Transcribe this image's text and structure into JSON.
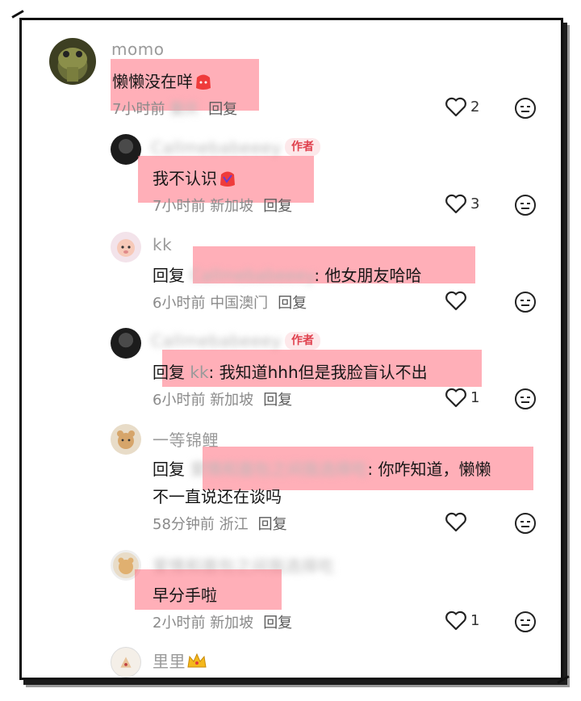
{
  "comments": [
    {
      "name": "momo",
      "text": "懒懒没在咩",
      "meta_time": "7小时前",
      "meta_loc": "重庆",
      "reply": "回复",
      "likes": "2"
    },
    {
      "name": "Callmebabeeey",
      "badge": "作者",
      "text": "我不认识",
      "meta_time": "7小时前",
      "meta_loc": "新加坡",
      "reply": "回复",
      "likes": "3"
    },
    {
      "name": "kk",
      "reply_prefix": "回复",
      "mention": "Callmebabeeey",
      "text": ": 他女朋友哈哈",
      "meta_time": "6小时前",
      "meta_loc": "中国澳门",
      "reply": "回复",
      "likes": ""
    },
    {
      "name": "Callmebabeeey",
      "badge": "作者",
      "reply_prefix": "回复",
      "mention": "kk",
      "text": ": 我知道hhh但是我脸盲认不出",
      "meta_time": "6小时前",
      "meta_loc": "新加坡",
      "reply": "回复",
      "likes": "1"
    },
    {
      "name": "一等锦鲤",
      "reply_prefix": "回复",
      "mention": "爱情和面包之间我选择吃",
      "text": ": 你咋知道，懒懒",
      "text_line2": "不一直说还在谈吗",
      "meta_time": "58分钟前",
      "meta_loc": "浙江",
      "reply": "回复",
      "likes": ""
    },
    {
      "name": "爱情和面包之间我选择吃",
      "text": "早分手啦",
      "meta_time": "2小时前",
      "meta_loc": "新加坡",
      "reply": "回复",
      "likes": "1"
    },
    {
      "name": "里里"
    }
  ]
}
